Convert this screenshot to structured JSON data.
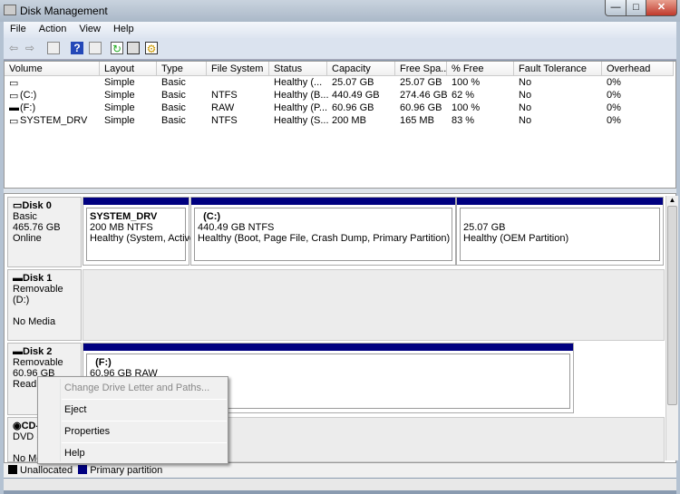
{
  "window": {
    "title": "Disk Management",
    "minimize": "—",
    "maximize": "□",
    "close": "✕"
  },
  "menubar": [
    "File",
    "Action",
    "View",
    "Help"
  ],
  "toolbar": [
    "back-icon",
    "forward-icon",
    "console-tree-icon",
    "help-icon",
    "show-pane-icon",
    "refresh-icon",
    "properties-icon",
    "rescan-icon"
  ],
  "volume_list": {
    "columns": [
      "Volume",
      "Layout",
      "Type",
      "File System",
      "Status",
      "Capacity",
      "Free Spa...",
      "% Free",
      "Fault Tolerance",
      "Overhead"
    ],
    "rows": [
      [
        "",
        "Simple",
        "Basic",
        "",
        "Healthy (...",
        "25.07 GB",
        "25.07 GB",
        "100 %",
        "No",
        "0%"
      ],
      [
        "(C:)",
        "Simple",
        "Basic",
        "NTFS",
        "Healthy (B...",
        "440.49 GB",
        "274.46 GB",
        "62 %",
        "No",
        "0%"
      ],
      [
        "(F:)",
        "Simple",
        "Basic",
        "RAW",
        "Healthy (P...",
        "60.96 GB",
        "60.96 GB",
        "100 %",
        "No",
        "0%"
      ],
      [
        "SYSTEM_DRV",
        "Simple",
        "Basic",
        "NTFS",
        "Healthy (S...",
        "200 MB",
        "165 MB",
        "83 %",
        "No",
        "0%"
      ]
    ]
  },
  "disks": [
    {
      "name": "Disk 0",
      "lines": [
        "Basic",
        "465.76 GB",
        "Online"
      ],
      "partitions": [
        {
          "name": "SYSTEM_DRV",
          "size": "200 MB NTFS",
          "status": "Healthy (System, Active,"
        },
        {
          "name": "(C:)",
          "size": "440.49 GB NTFS",
          "status": "Healthy (Boot, Page File, Crash Dump, Primary Partition)"
        },
        {
          "name": "",
          "size": "25.07 GB",
          "status": "Healthy (OEM Partition)"
        }
      ]
    },
    {
      "name": "Disk 1",
      "lines": [
        "Removable (D:)",
        "",
        "No Media"
      ]
    },
    {
      "name": "Disk 2",
      "lines": [
        "Removable",
        "60.96 GB",
        "Read O"
      ],
      "partitions": [
        {
          "name": "(F:)",
          "size": "60.96 GB RAW"
        }
      ]
    },
    {
      "name": "CD-",
      "lines": [
        "DVD (E",
        "",
        "No Me"
      ]
    }
  ],
  "legend": [
    {
      "label": "Unallocated",
      "color": "#000000"
    },
    {
      "label": "Primary partition",
      "color": "#000080"
    }
  ],
  "context_menu": {
    "items": [
      {
        "label": "Change Drive Letter and Paths...",
        "disabled": true
      },
      {
        "label": "Eject"
      },
      {
        "label": "Properties"
      },
      {
        "label": "Help"
      }
    ]
  }
}
